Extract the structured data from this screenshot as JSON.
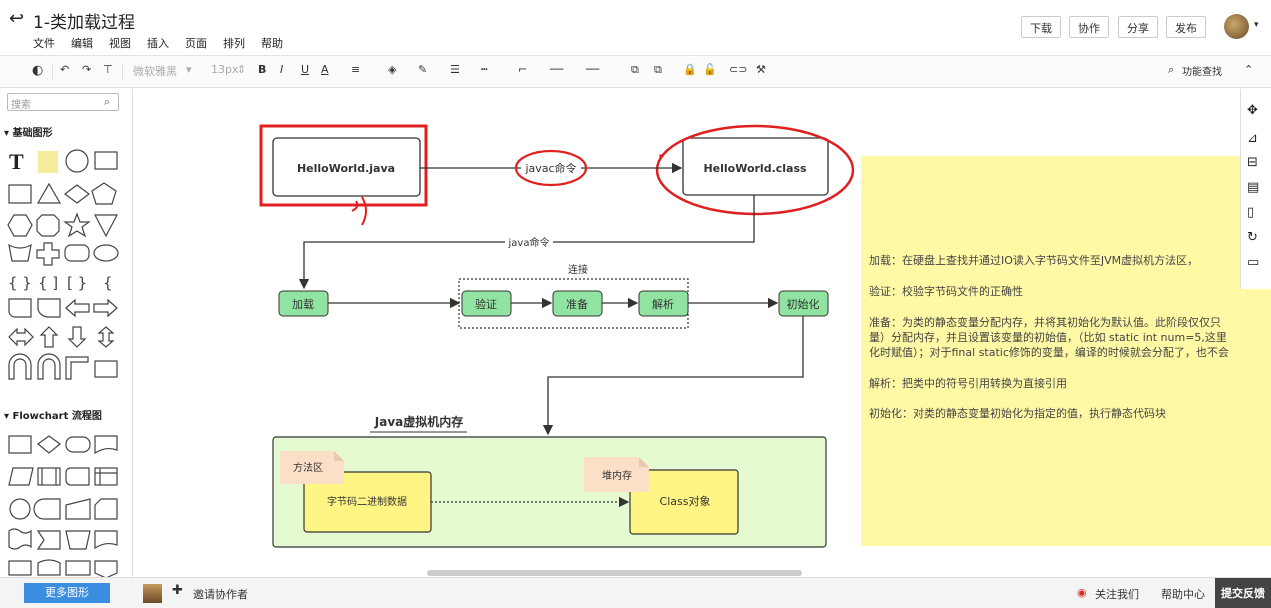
{
  "header": {
    "back_icon": "back-arrow-icon",
    "title": "1-类加载过程",
    "menu": [
      "文件",
      "编辑",
      "视图",
      "插入",
      "页面",
      "排列",
      "帮助"
    ],
    "buttons": {
      "download": "下载",
      "collab": "协作",
      "share": "分享",
      "publish": "发布"
    }
  },
  "toolbar": {
    "font": "微软雅黑",
    "size": "13px",
    "search": "功能查找"
  },
  "sidebar": {
    "search_placeholder": "搜索",
    "basic_title": "基础图形",
    "flowchart_title": "Flowchart 流程图"
  },
  "diagram": {
    "java_file": "HelloWorld.java",
    "class_file": "HelloWorld.class",
    "javac_label": "javac命令",
    "java_label": "java命令",
    "load": "加载",
    "link_group": "连接",
    "verify": "验证",
    "prepare": "准备",
    "resolve": "解析",
    "init": "初始化",
    "jvm_title": "Java虚拟机内存",
    "method_area": "方法区",
    "bytecode": "字节码二进制数据",
    "heap": "堆内存",
    "class_obj": "Class对象"
  },
  "note": {
    "p1": "加载：在硬盘上查找并通过IO读入字节码文件至JVM虚拟机方法区，",
    "p2": "验证：校验字节码文件的正确性",
    "p3a": "准备：为类的静态变量分配内存，并将其初始化为默认值。此阶段仅仅只",
    "p3b": "量）分配内存，并且设置该变量的初始值，（比如 static int num=5,这里",
    "p3c": "化时赋值）；对于final static修饰的变量，编译的时候就会分配了，也不会",
    "p4": "解析：把类中的符号引用转换为直接引用",
    "p5": "初始化：对类的静态变量初始化为指定的值，执行静态代码块"
  },
  "footer": {
    "more_shapes": "更多图形",
    "invite": "邀请协作者",
    "follow": "关注我们",
    "help": "帮助中心",
    "feedback": "提交反馈"
  }
}
